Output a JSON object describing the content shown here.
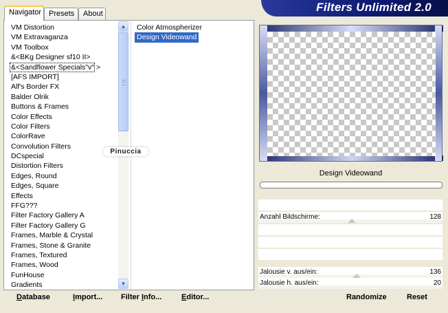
{
  "banner": {
    "title": "Filters Unlimited 2.0"
  },
  "tabs": [
    {
      "label": "Navigator",
      "active": true
    },
    {
      "label": "Presets",
      "active": false
    },
    {
      "label": "About",
      "active": false
    }
  ],
  "filter_list": [
    "VM Distortion",
    "VM Extravaganza",
    "VM Toolbox",
    "&<BKg Designer sf10 II>",
    "&<Sandflower Specials\"v\" >",
    "[AFS IMPORT]",
    "Alf's Border FX",
    "Balder Olrik",
    "Buttons & Frames",
    "Color Effects",
    "Color Filters",
    "ColorRave",
    "Convolution Filters",
    "DCspecial",
    "Distortion Filters",
    "Edges, Round",
    "Edges, Square",
    "Effects",
    "FFG???",
    "Filter Factory Gallery A",
    "Filter Factory Gallery G",
    "Frames, Marble & Crystal",
    "Frames, Stone & Granite",
    "Frames, Textured",
    "Frames, Wood",
    "FunHouse",
    "Gradients"
  ],
  "focused_index": 4,
  "sub_list": [
    {
      "label": "Color Atmospherizer",
      "selected": false
    },
    {
      "label": "Design Videowand",
      "selected": true
    }
  ],
  "watermark": "Pinuccia",
  "preview": {
    "filter_name": "Design Videowand"
  },
  "params": [
    {
      "label": "Anzahl Bildschirme:",
      "value": "128",
      "level": 0.5
    },
    {
      "label": "Jalousie v. aus/ein:",
      "value": "136",
      "level": 0.53
    },
    {
      "label": "Jalousie h. aus/ein:",
      "value": "20",
      "level": null
    }
  ],
  "buttons": {
    "database": {
      "u": "D",
      "rest": "atabase"
    },
    "import": {
      "u": "I",
      "rest": "mport..."
    },
    "filterinfo": {
      "pre": "Filter ",
      "u": "I",
      "rest": "nfo..."
    },
    "editor": {
      "u": "E",
      "rest": "ditor..."
    },
    "randomize": "Randomize",
    "reset": "Reset"
  },
  "icons": {
    "scroll_up": "scroll-up-arrow-icon",
    "scroll_down": "scroll-down-arrow-icon"
  },
  "colors": {
    "banner": "#0d1a72",
    "selection": "#316ac5",
    "tab_highlight": "#ffc83c"
  }
}
